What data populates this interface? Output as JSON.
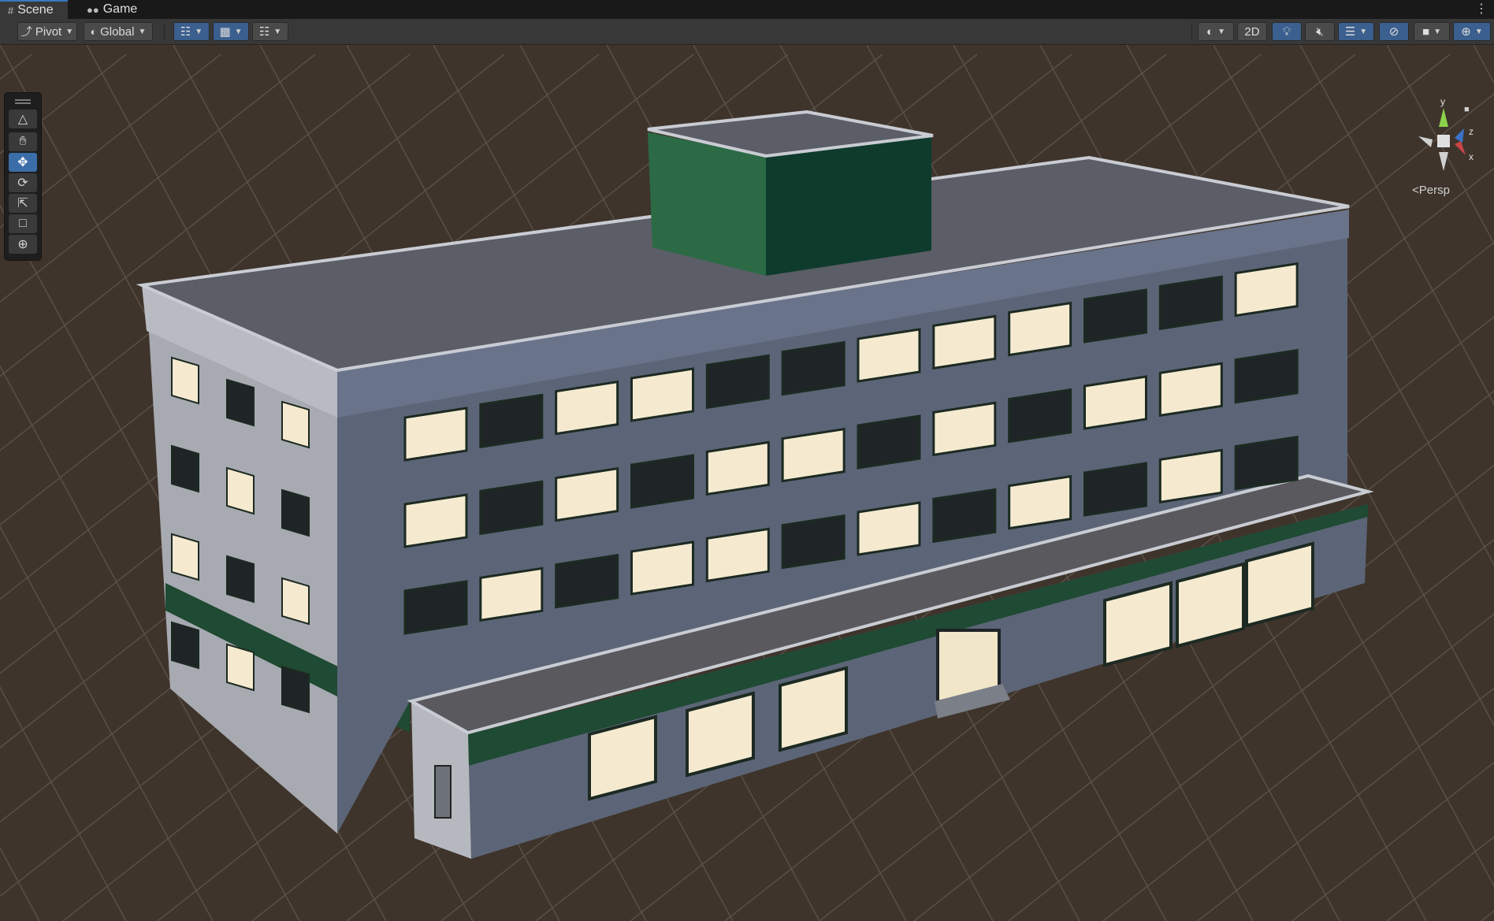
{
  "tabs": [
    {
      "label": "Scene",
      "icon": "grid-icon",
      "active": true
    },
    {
      "label": "Game",
      "icon": "gamepad-icon",
      "active": false
    }
  ],
  "toolbar": {
    "pivot_label": "Pivot",
    "global_label": "Global",
    "mode_2d_label": "2D"
  },
  "tools": [
    {
      "name": "view-tool",
      "icon": "cube-icon",
      "active": false
    },
    {
      "name": "hand-tool",
      "icon": "hand-icon",
      "active": false
    },
    {
      "name": "move-tool",
      "icon": "move-arrows-icon",
      "active": true
    },
    {
      "name": "rotate-tool",
      "icon": "rotate-icon",
      "active": false
    },
    {
      "name": "scale-tool",
      "icon": "scale-icon",
      "active": false
    },
    {
      "name": "rect-tool",
      "icon": "rect-icon",
      "active": false
    },
    {
      "name": "transform-tool",
      "icon": "transform-icon",
      "active": false
    }
  ],
  "gizmo": {
    "projection_label": "Persp",
    "axis_y": "y",
    "axis_z": "z",
    "axis_x": "x"
  },
  "colors": {
    "ground": "#3e342b",
    "grid_line": "#5a5048",
    "facade": "#5c6577",
    "side_wall": "#a7aab0",
    "trim_green": "#1f4a33",
    "roof": "#5b5e66",
    "window_lit": "#f5ead0",
    "window_dark": "#1f2426",
    "accent_blue": "#3b6ea8"
  }
}
